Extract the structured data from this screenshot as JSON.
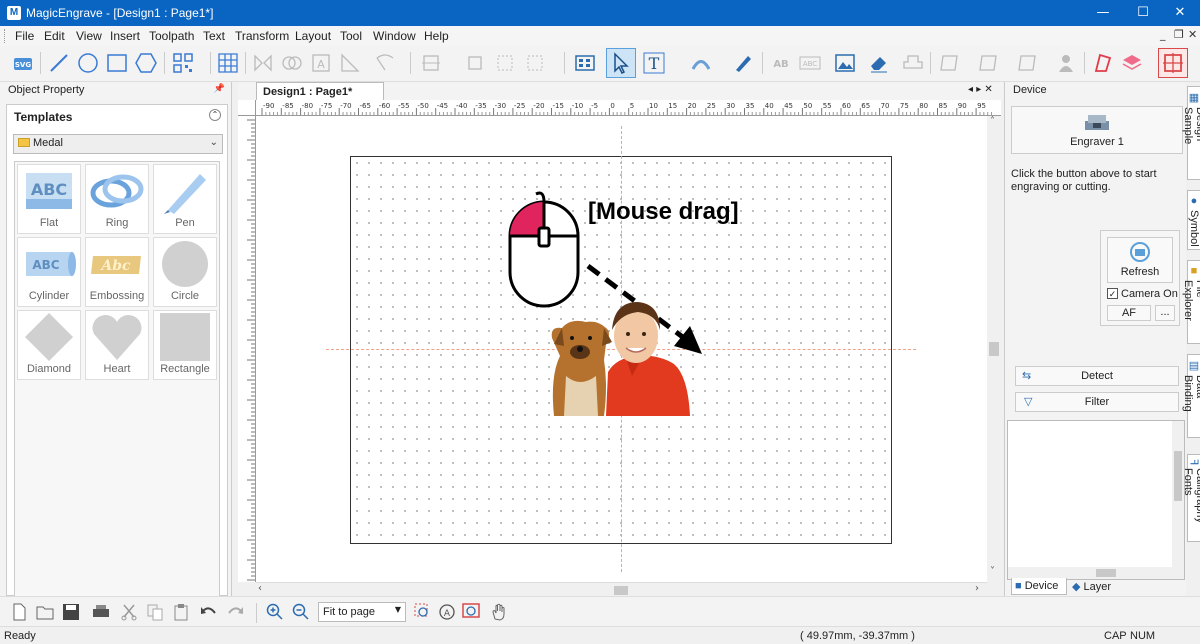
{
  "window": {
    "app_title": "MagicEngrave - [Design1 : Page1*]",
    "logo_letter": "M"
  },
  "menu": [
    "File",
    "Edit",
    "View",
    "Insert",
    "Toolpath",
    "Text",
    "Transform",
    "Layout",
    "Tool",
    "Window",
    "Help"
  ],
  "toolbar": {
    "svg_label": "SVG",
    "text_tool": "T",
    "ab_label_1": "AB",
    "ab_label_2": "ABC"
  },
  "left_pane": {
    "header": "Object Property",
    "pin": "📌",
    "templates_title": "Templates",
    "category": "Medal",
    "items": [
      {
        "label": "Flat",
        "thumb_text": "ABC"
      },
      {
        "label": "Ring"
      },
      {
        "label": "Pen"
      },
      {
        "label": "Cylinder",
        "thumb_text": "ABC"
      },
      {
        "label": "Embossing",
        "thumb_text": "Abc"
      },
      {
        "label": "Circle"
      },
      {
        "label": "Diamond"
      },
      {
        "label": "Heart"
      },
      {
        "label": "Rectangle"
      }
    ]
  },
  "document": {
    "tab": "Design1 : Page1*"
  },
  "ruler": {
    "h_labels": [
      "-90",
      "-85",
      "-80",
      "-75",
      "-70",
      "-65",
      "-60",
      "-55",
      "-50",
      "-45",
      "-40",
      "-35",
      "-30",
      "-25",
      "-20",
      "-15",
      "-10",
      "-5",
      "0",
      "5",
      "10",
      "15",
      "20",
      "25",
      "30",
      "35",
      "40",
      "45",
      "50",
      "55",
      "60",
      "65",
      "70",
      "75",
      "80",
      "85",
      "90",
      "95"
    ]
  },
  "canvas": {
    "annotation": "[Mouse drag]"
  },
  "right_pane": {
    "header": "Device",
    "engraver": "Engraver 1",
    "hint": "Click the button above to start engraving or cutting.",
    "refresh": "Refresh",
    "camera_on": "Camera On",
    "af": "AF",
    "more": "...",
    "detect": "Detect",
    "filter": "Filter",
    "tab_device": "Device",
    "tab_layer": "Layer"
  },
  "side_tabs": [
    "Design Sample",
    "Symbol",
    "File Explorer",
    "Data Binding",
    "Calligraphy Fonts"
  ],
  "bottom": {
    "zoom_mode": "Fit to page"
  },
  "status": {
    "ready": "Ready",
    "coords": "( 49.97mm, -39.37mm )",
    "cap": "CAP",
    "num": "NUM"
  }
}
